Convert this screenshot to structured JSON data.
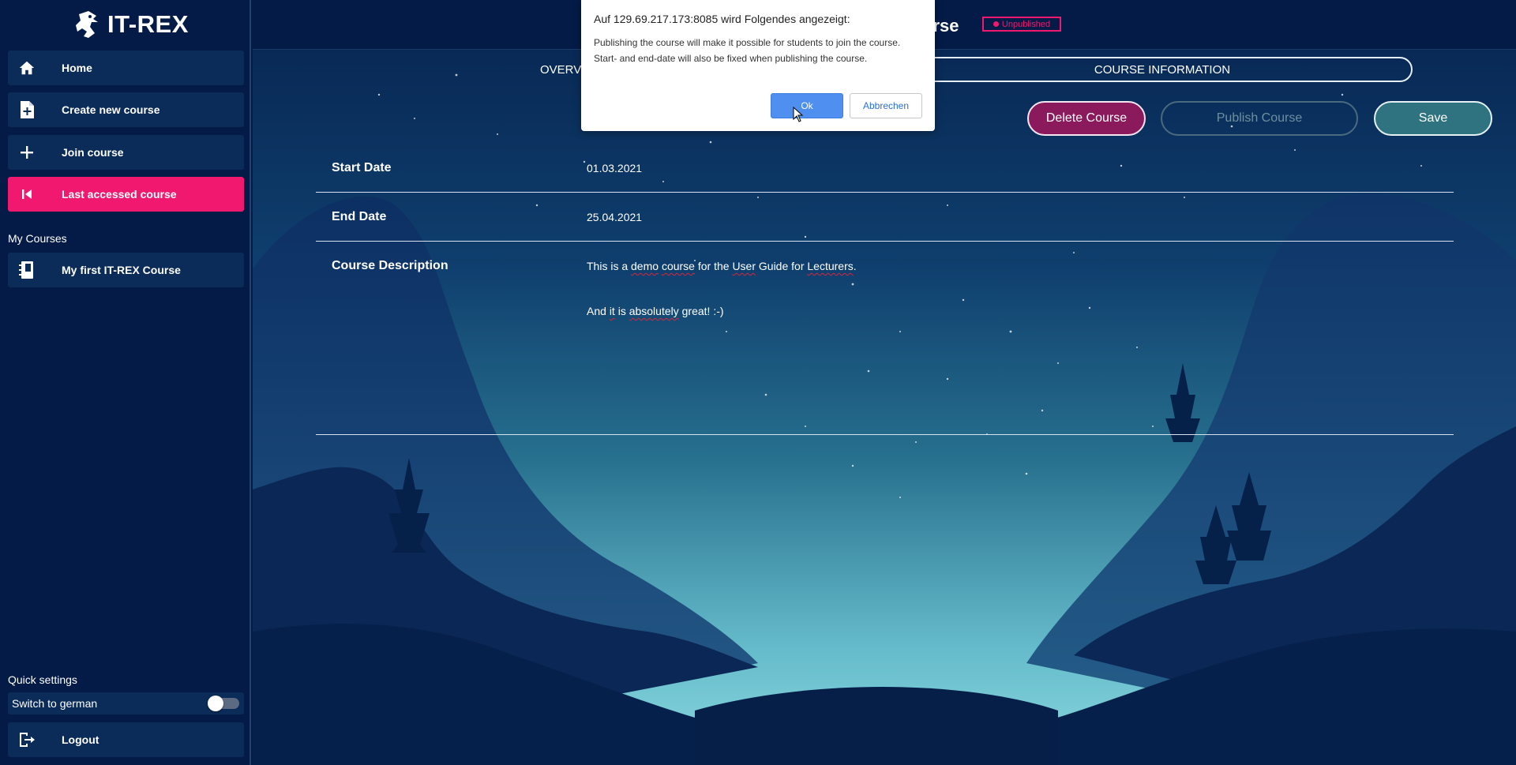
{
  "app": {
    "name": "IT-REX"
  },
  "sidebar": {
    "nav": [
      {
        "label": "Home",
        "icon": "home-icon"
      },
      {
        "label": "Create new course",
        "icon": "file-plus-icon"
      },
      {
        "label": "Join course",
        "icon": "plus-icon"
      },
      {
        "label": "Last accessed course",
        "icon": "skip-back-icon",
        "active": true
      }
    ],
    "my_courses_label": "My Courses",
    "courses": [
      {
        "label": "My first IT-REX Course",
        "icon": "notebook-icon"
      }
    ],
    "quick_settings_label": "Quick settings",
    "switch_label": "Switch to german",
    "switch_on": false,
    "logout_label": "Logout"
  },
  "header": {
    "title_partial": "urse",
    "status_badge": "Unpublished",
    "tabs": [
      {
        "label": "OVERVI"
      },
      {
        "label": "COURSE INFORMATION",
        "active": true
      }
    ]
  },
  "actions": {
    "delete": "Delete Course",
    "publish": "Publish Course",
    "save": "Save"
  },
  "course_info": {
    "start_date_label": "Start Date",
    "start_date": "01.03.2021",
    "end_date_label": "End Date",
    "end_date": "25.04.2021",
    "description_label": "Course Description",
    "description_line1_parts": [
      "This is a ",
      "demo",
      " ",
      "course",
      " for the ",
      "User",
      " Guide for ",
      "Lecturers",
      "."
    ],
    "description_line2_parts": [
      "And ",
      "it",
      " is ",
      "absolutely",
      " great! :-)"
    ]
  },
  "dialog": {
    "title": "Auf 129.69.217.173:8085 wird Folgendes angezeigt:",
    "message": "Publishing the course will make it possible for students to join the course. Start- and end-date will also be fixed when publishing the course.",
    "ok": "Ok",
    "cancel": "Abbrechen"
  },
  "colors": {
    "sidebar_bg": "#031b46",
    "accent": "#f0196f",
    "delete": "#8b1a5c",
    "save": "#2f7380",
    "dialog_ok": "#4e8ff0"
  }
}
